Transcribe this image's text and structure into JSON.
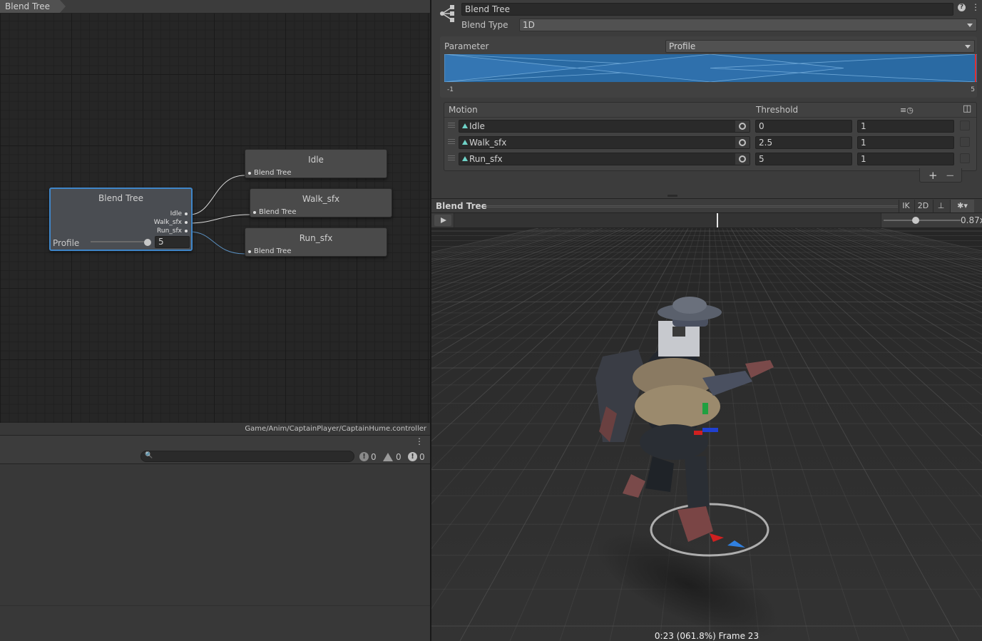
{
  "graph": {
    "breadcrumb": "Blend Tree",
    "blend_node": {
      "title": "Blend Tree",
      "outputs": [
        "Idle",
        "Walk_sfx",
        "Run_sfx"
      ],
      "parameter": "Profile",
      "value": "5"
    },
    "child_nodes": [
      {
        "title": "Idle",
        "port": "Blend Tree"
      },
      {
        "title": "Walk_sfx",
        "port": "Blend Tree"
      },
      {
        "title": "Run_sfx",
        "port": "Blend Tree"
      }
    ],
    "asset_path": "Game/Anim/CaptainPlayer/CaptainHume.controller"
  },
  "console": {
    "menu": "⋮",
    "search_placeholder": "",
    "info_count": "0",
    "warning_count": "0",
    "error_count": "0"
  },
  "inspector": {
    "name": "Blend Tree",
    "help": "?",
    "menu": "⋮",
    "blend_type_label": "Blend Type",
    "blend_type_value": "1D",
    "parameter_label": "Parameter",
    "parameter_value": "Profile",
    "range_min": "-1",
    "range_max": "5",
    "motion_header": "Motion",
    "threshold_header": "Threshold",
    "motions": [
      {
        "clip": "Idle",
        "threshold": "0",
        "speed": "1"
      },
      {
        "clip": "Walk_sfx",
        "threshold": "2.5",
        "speed": "1"
      },
      {
        "clip": "Run_sfx",
        "threshold": "5",
        "speed": "1"
      }
    ],
    "add": "+",
    "remove": "−"
  },
  "preview": {
    "title": "Blend Tree",
    "buttons": [
      "IK",
      "2D"
    ],
    "playback_fraction": 0.618,
    "speed_value": "0.87x",
    "status": "0:23 (061.8%) Frame 23"
  },
  "colors": {
    "accent": "#3f86c9",
    "blend_fill": "#2a6aa3",
    "clip_icon": "#6fd3c8"
  }
}
